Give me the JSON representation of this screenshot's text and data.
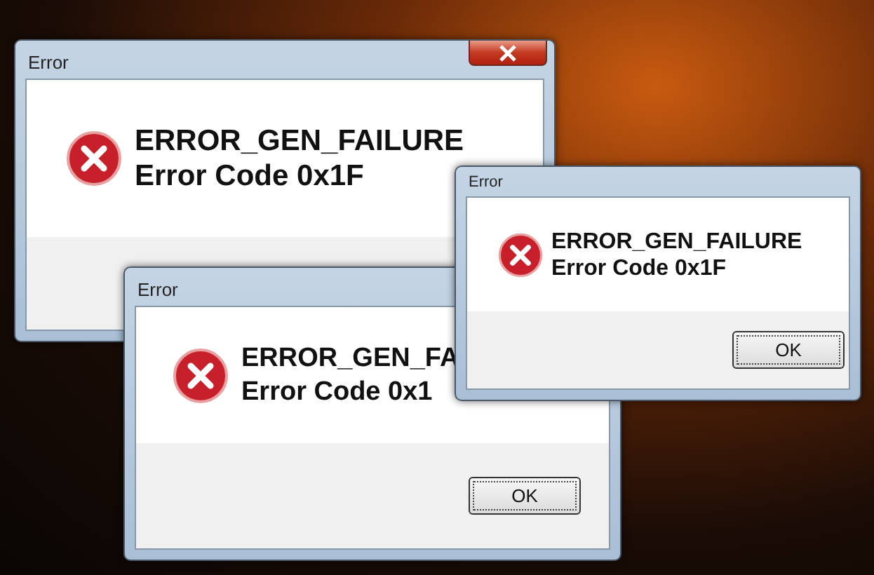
{
  "windows": [
    {
      "title": "Error",
      "has_close_button": true,
      "message": [
        "ERROR_GEN_FAILURE",
        "Error Code 0x1F"
      ]
    },
    {
      "title": "Error",
      "message": [
        "ERROR_GEN_FA",
        "Error Code 0x1"
      ],
      "button": "OK"
    },
    {
      "title": "Error",
      "message": [
        "ERROR_GEN_FAILURE",
        "Error Code 0x1F"
      ],
      "button": "OK"
    }
  ]
}
